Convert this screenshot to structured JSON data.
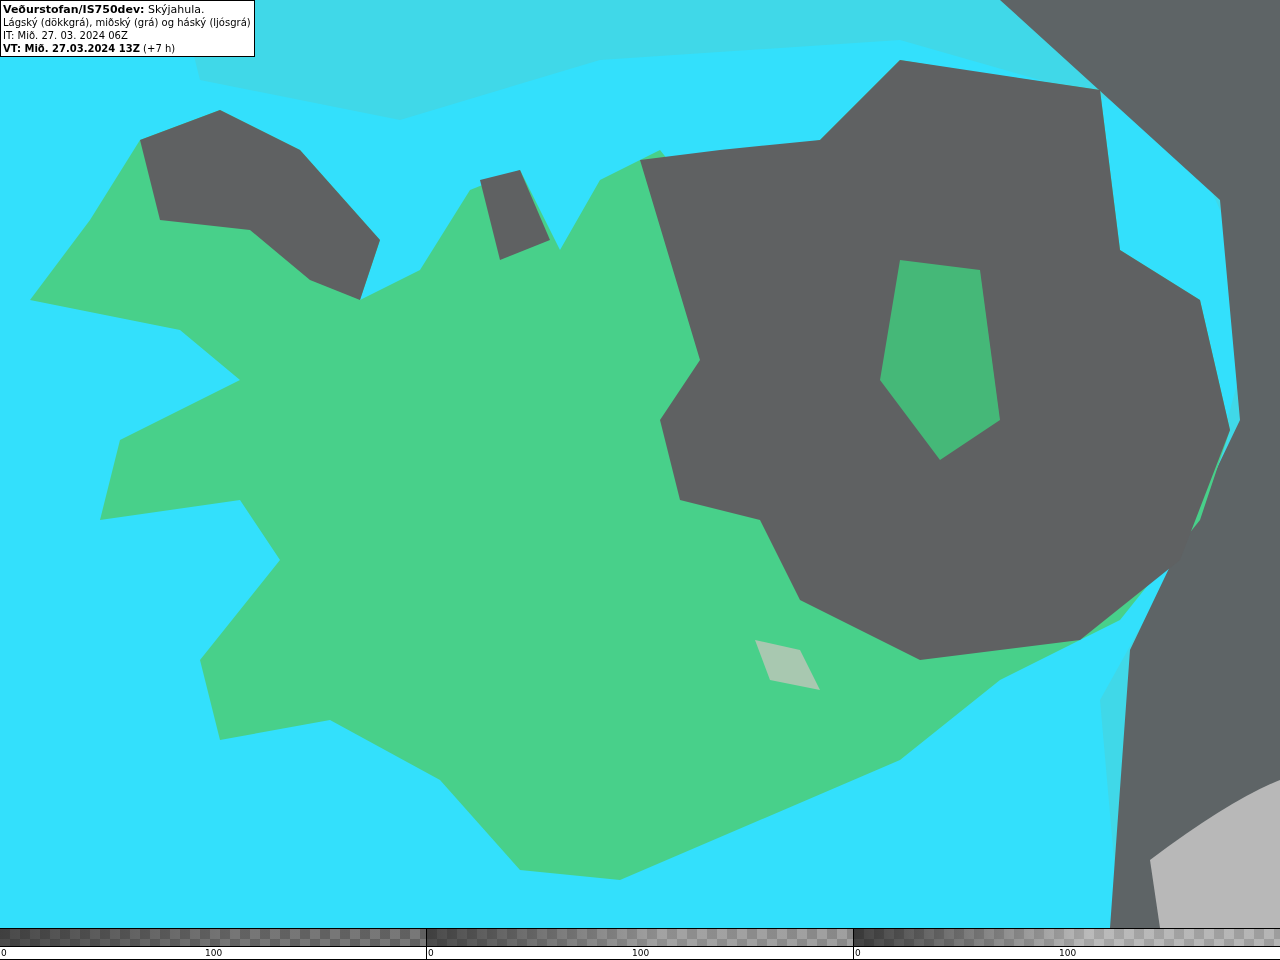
{
  "info_box": {
    "lines": [
      "**Veðurstofan/IS750dev:** Skýjahula.",
      "Lágský (dökkgrá), miðský (grá) og háský (ljósgrá)",
      "IT: Mið. 27. 03. 2024 06Z",
      "**VT: Mið. 27.03.2024 13Z** (+7 h)"
    ]
  },
  "legend": [
    {
      "kind": "low",
      "labels": [
        "0",
        "100"
      ]
    },
    {
      "kind": "mid",
      "labels": [
        "0",
        "100"
      ]
    },
    {
      "kind": "high",
      "labels": [
        "0",
        "100"
      ]
    }
  ]
}
